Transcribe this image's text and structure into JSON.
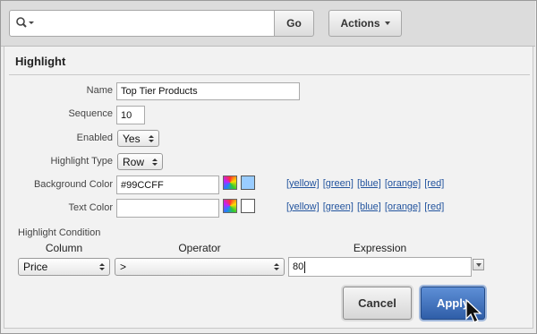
{
  "toolbar": {
    "search_value": "",
    "go_label": "Go",
    "actions_label": "Actions"
  },
  "panel": {
    "title": "Highlight"
  },
  "form": {
    "name_label": "Name",
    "name_value": "Top Tier Products",
    "sequence_label": "Sequence",
    "sequence_value": "10",
    "enabled_label": "Enabled",
    "enabled_value": "Yes",
    "highlight_type_label": "Highlight Type",
    "highlight_type_value": "Row",
    "bg_color_label": "Background Color",
    "bg_color_value": "#99CCFF",
    "bg_color_swatch": "#99CCFF",
    "text_color_label": "Text Color",
    "text_color_value": "",
    "text_color_swatch": "#FFFFFF",
    "quick_colors": [
      "[yellow]",
      "[green]",
      "[blue]",
      "[orange]",
      "[red]"
    ]
  },
  "condition": {
    "section_label": "Highlight Condition",
    "column_header": "Column",
    "operator_header": "Operator",
    "expression_header": "Expression",
    "column_value": "Price",
    "operator_value": ">",
    "expression_value": "80"
  },
  "buttons": {
    "cancel_label": "Cancel",
    "apply_label": "Apply"
  },
  "colors": {
    "apply_bg": "#3a6bb8",
    "link": "#23549e"
  }
}
